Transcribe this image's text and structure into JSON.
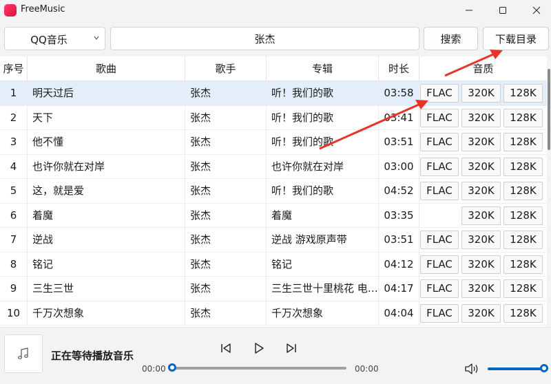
{
  "window": {
    "title": "FreeMusic",
    "logo_text": "music"
  },
  "toolbar": {
    "source": "QQ音乐",
    "search_value": "张杰",
    "search_label": "搜索",
    "download_dir_label": "下载目录"
  },
  "table": {
    "headers": {
      "idx": "序号",
      "song": "歌曲",
      "artist": "歌手",
      "album": "专辑",
      "duration": "时长",
      "quality": "音质"
    },
    "rows": [
      {
        "idx": "1",
        "song": "明天过后",
        "artist": "张杰",
        "album": "听！我们的歌",
        "duration": "03:58",
        "flac": "FLAC",
        "q320": "320K",
        "q128": "128K"
      },
      {
        "idx": "2",
        "song": "天下",
        "artist": "张杰",
        "album": "听！我们的歌",
        "duration": "03:41",
        "flac": "FLAC",
        "q320": "320K",
        "q128": "128K"
      },
      {
        "idx": "3",
        "song": "他不懂",
        "artist": "张杰",
        "album": "听！我们的歌",
        "duration": "03:51",
        "flac": "FLAC",
        "q320": "320K",
        "q128": "128K"
      },
      {
        "idx": "4",
        "song": "也许你就在对岸",
        "artist": "张杰",
        "album": "也许你就在对岸",
        "duration": "03:00",
        "flac": "FLAC",
        "q320": "320K",
        "q128": "128K"
      },
      {
        "idx": "5",
        "song": "这，就是爱",
        "artist": "张杰",
        "album": "听！我们的歌",
        "duration": "04:52",
        "flac": "FLAC",
        "q320": "320K",
        "q128": "128K"
      },
      {
        "idx": "6",
        "song": "着魔",
        "artist": "张杰",
        "album": "着魔",
        "duration": "03:35",
        "flac": "",
        "q320": "320K",
        "q128": "128K"
      },
      {
        "idx": "7",
        "song": "逆战",
        "artist": "张杰",
        "album": "逆战 游戏原声带",
        "duration": "03:51",
        "flac": "FLAC",
        "q320": "320K",
        "q128": "128K"
      },
      {
        "idx": "8",
        "song": "铭记",
        "artist": "张杰",
        "album": "铭记",
        "duration": "04:12",
        "flac": "FLAC",
        "q320": "320K",
        "q128": "128K"
      },
      {
        "idx": "9",
        "song": "三生三世",
        "artist": "张杰",
        "album": "三生三世十里桃花 电视原声带",
        "duration": "04:17",
        "flac": "FLAC",
        "q320": "320K",
        "q128": "128K"
      },
      {
        "idx": "10",
        "song": "千万次想象",
        "artist": "张杰",
        "album": "千万次想象",
        "duration": "04:04",
        "flac": "FLAC",
        "q320": "320K",
        "q128": "128K"
      }
    ]
  },
  "player": {
    "status": "正在等待播放音乐",
    "current_time": "00:00",
    "total_time": "00:00",
    "progress": 0,
    "volume": 1.0
  },
  "colors": {
    "accent": "#0067c0",
    "selected_row": "#e4eefa",
    "annotation_arrow": "#e8332b"
  }
}
